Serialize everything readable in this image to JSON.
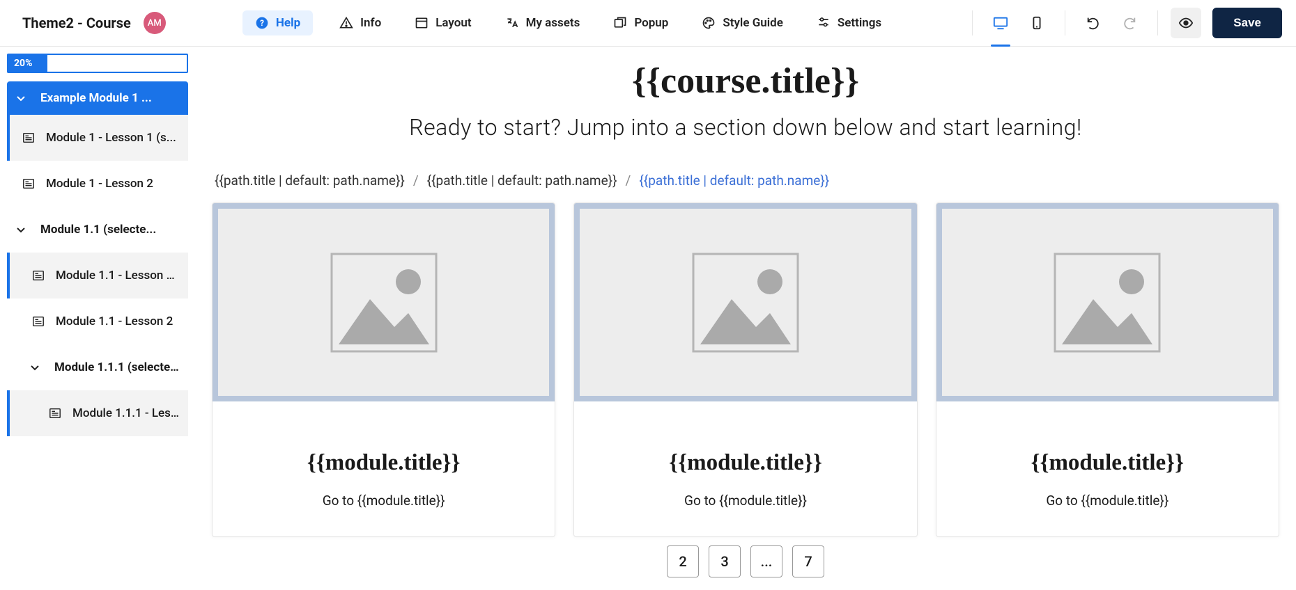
{
  "header": {
    "title": "Theme2 - Course",
    "avatar_initials": "AM",
    "buttons": {
      "help": "Help",
      "info": "Info",
      "layout": "Layout",
      "assets": "My assets",
      "popup": "Popup",
      "style": "Style Guide",
      "settings": "Settings"
    },
    "save": "Save"
  },
  "sidebar": {
    "progress_label": "20%",
    "module_header": "Example Module 1 ...",
    "items": [
      {
        "label": "Module 1 - Lesson 1 (s..."
      },
      {
        "label": "Module 1 - Lesson 2"
      }
    ],
    "sub1": "Module 1.1 (selecte...",
    "sub1_items": [
      {
        "label": "Module 1.1 - Lesson 1..."
      },
      {
        "label": "Module 1.1 - Lesson 2"
      }
    ],
    "sub2": "Module 1.1.1 (selecte...",
    "sub2_items": [
      {
        "label": "Module 1.1.1 - Les..."
      }
    ]
  },
  "main": {
    "title": "{{course.title}}",
    "subtitle": "Ready to start? Jump into a section down below and start learning!",
    "breadcrumb_segment": "{{path.title | default: path.name}}",
    "breadcrumb_sep": "/",
    "card_title": "{{module.title}}",
    "card_link": "Go to {{module.title}}",
    "pager": [
      "2",
      "3",
      "...",
      "7"
    ]
  }
}
